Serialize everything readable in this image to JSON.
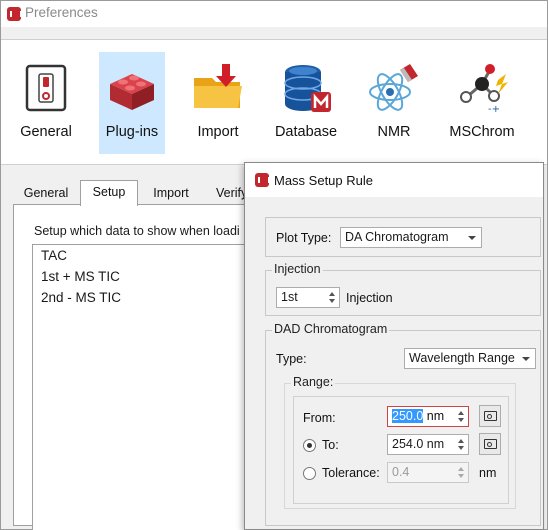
{
  "preferences": {
    "title": "Preferences",
    "toolbar": [
      {
        "label": "General",
        "icon": "power-switch-icon"
      },
      {
        "label": "Plug-ins",
        "icon": "brick-icon",
        "selected": true
      },
      {
        "label": "Import",
        "icon": "folder-import-icon"
      },
      {
        "label": "Database",
        "icon": "database-icon"
      },
      {
        "label": "NMR",
        "icon": "atom-magnet-icon"
      },
      {
        "label": "MSChrom",
        "icon": "molecule-icon"
      }
    ],
    "tabs": [
      "General",
      "Setup",
      "Import",
      "Verify"
    ],
    "active_tab": "Setup",
    "setup_label": "Setup which data to show when loadi",
    "data_items": [
      "TAC",
      "1st + MS TIC",
      "2nd - MS TIC"
    ]
  },
  "dialog": {
    "title": "Mass Setup Rule",
    "plot_type_label": "Plot Type:",
    "plot_type_value": "DA Chromatogram",
    "injection_group": "Injection",
    "injection_value": "1st",
    "injection_label": "Injection",
    "dad_group": "DAD Chromatogram",
    "type_label": "Type:",
    "type_value": "Wavelength Range",
    "range_group": "Range:",
    "from_label": "From:",
    "from_value": "250.0",
    "from_unit": "nm",
    "to_label": "To:",
    "to_value": "254.0 nm",
    "tolerance_label": "Tolerance:",
    "tolerance_value": "0.4",
    "tolerance_unit": "nm"
  },
  "colors": {
    "brand_red": "#c1272d",
    "selection_blue": "#cde8ff",
    "text_selection": "#3399ff"
  }
}
